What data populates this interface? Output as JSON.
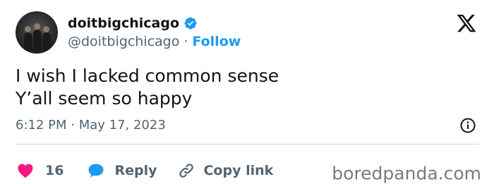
{
  "author": {
    "display_name": "doitbigchicago",
    "handle": "@doitbigchicago",
    "separator": "·",
    "follow_label": "Follow",
    "verified": true
  },
  "tweet": {
    "text": "I wish I lacked common sense\nY’all seem so happy",
    "timestamp": "6:12 PM · May 17, 2023"
  },
  "actions": {
    "like_count": "16",
    "reply_label": "Reply",
    "copy_link_label": "Copy link"
  },
  "icons": {
    "like": "heart-icon",
    "reply": "speech-bubble-icon",
    "copy_link": "link-icon",
    "info": "info-icon",
    "logo": "x-logo-icon",
    "verified": "verified-badge-icon"
  },
  "colors": {
    "accent": "#1d9bf0",
    "like": "#f91880",
    "text_primary": "#0f1419",
    "text_secondary": "#536471",
    "divider": "#cfd9de"
  },
  "watermark": "boredpanda.com"
}
